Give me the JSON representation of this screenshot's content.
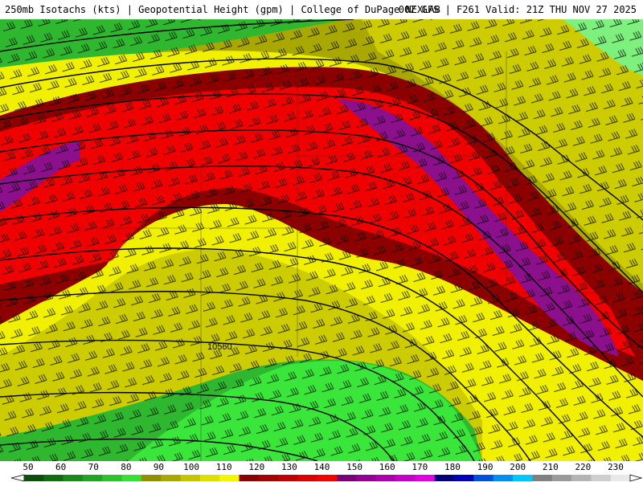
{
  "header": {
    "title": "250mb Isotachs (kts) | Geopotential Height (gpm) | College of DuPage NEXLAB",
    "run_info": "00Z GFS | F261 Valid: 21Z THU NOV 27 2025"
  },
  "map": {
    "contour_label": "10560",
    "fill_colors": {
      "dark_green": "#1f8a1f",
      "green": "#2fb82f",
      "bright_green": "#3be63b",
      "olive": "#a8a800",
      "yellow_olive": "#cccc00",
      "yellow": "#f0f000",
      "dark_red": "#8c0000",
      "crimson": "#b00000",
      "red": "#f00000",
      "purple": "#8c0f8c",
      "magenta": "#b010b0",
      "light_green": "#7ef07e"
    }
  },
  "colorbar": {
    "labels": [
      "50",
      "60",
      "70",
      "80",
      "90",
      "100",
      "110",
      "120",
      "130",
      "140",
      "150",
      "160",
      "170",
      "180",
      "190",
      "200",
      "210",
      "220",
      "230"
    ],
    "swatches": [
      "#0b4f0b",
      "#116b11",
      "#1a8a1a",
      "#22a522",
      "#2cc42c",
      "#36e036",
      "#8f8f00",
      "#a8a800",
      "#c4c400",
      "#e0e000",
      "#f5f500",
      "#8c0000",
      "#a60000",
      "#c00000",
      "#dc0000",
      "#f50000",
      "#7a007a",
      "#930093",
      "#ad00ad",
      "#c700c7",
      "#e000e0",
      "#00007a",
      "#0000b8",
      "#0050e0",
      "#0090f0",
      "#00c8ff",
      "#808080",
      "#9a9a9a",
      "#b4b4b4",
      "#cecece",
      "#e8e8e8"
    ]
  }
}
